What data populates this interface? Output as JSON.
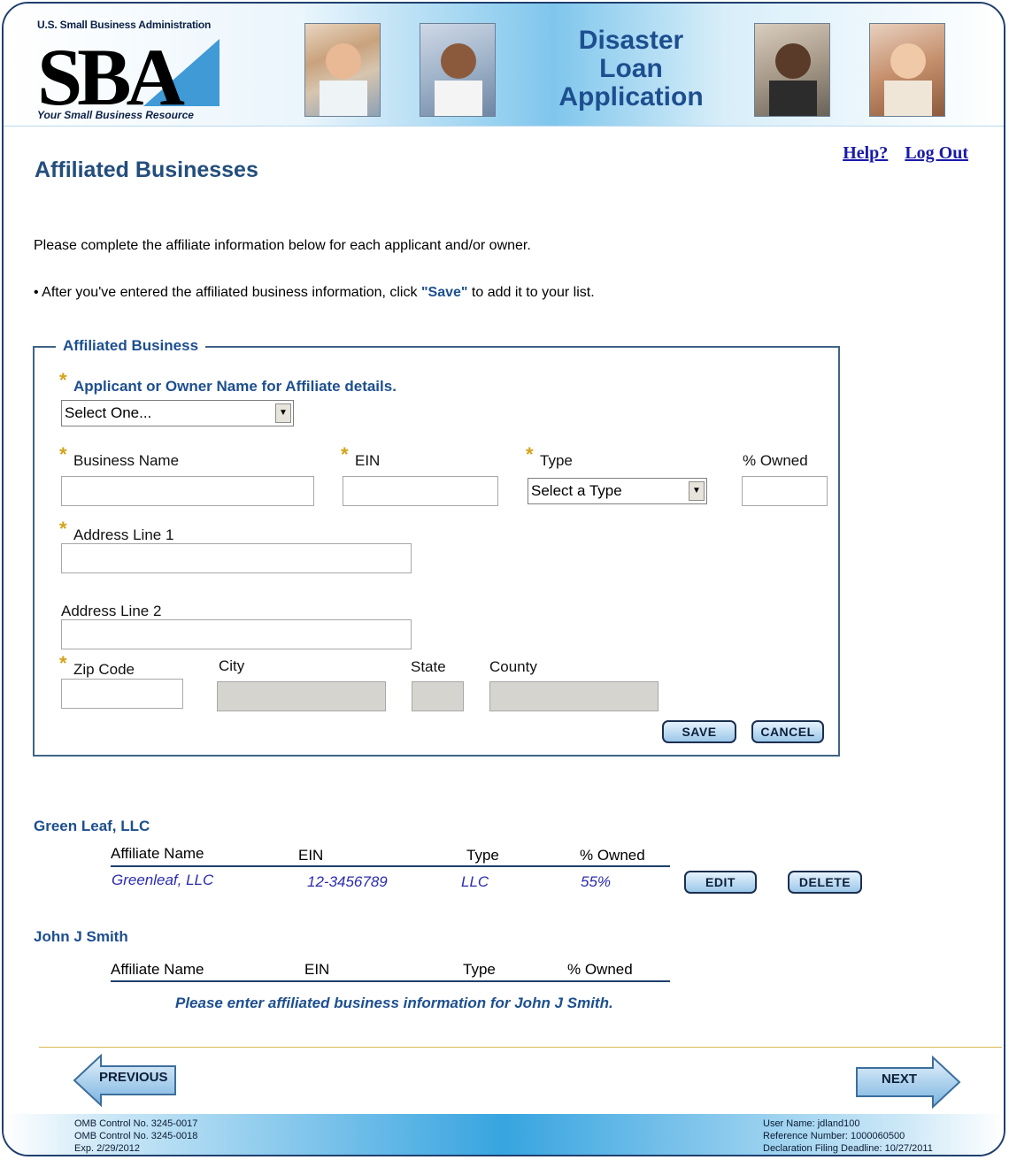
{
  "header": {
    "agency": "U.S. Small Business Administration",
    "logo_text": "SBA",
    "tagline": "Your Small Business Resource",
    "app_title_line1": "Disaster",
    "app_title_line2": "Loan",
    "app_title_line3": "Application",
    "help_link": "Help?",
    "logout_link": "Log Out"
  },
  "page": {
    "title": "Affiliated Businesses",
    "intro": "Please complete the affiliate information below for each applicant and/or owner.",
    "bullet_pre": "• After you've entered the affiliated business information, click ",
    "bullet_bold": "\"Save\"",
    "bullet_post": " to add it to your list."
  },
  "form": {
    "legend": "Affiliated Business",
    "owner_label": "Applicant or Owner Name for Affiliate details.",
    "owner_select": "Select One...",
    "business_name_label": "Business Name",
    "ein_label": "EIN",
    "type_label": "Type",
    "type_select": "Select a Type",
    "owned_label": "% Owned",
    "address1_label": "Address Line 1",
    "address2_label": "Address Line 2",
    "zip_label": "Zip Code",
    "city_label": "City",
    "state_label": "State",
    "county_label": "County",
    "save_button": "SAVE",
    "cancel_button": "CANCEL"
  },
  "columns": {
    "name": "Affiliate Name",
    "ein": "EIN",
    "type": "Type",
    "owned": "% Owned"
  },
  "groups": [
    {
      "owner": "Green Leaf, LLC",
      "row": {
        "name": "Greenleaf, LLC",
        "ein": "12-3456789",
        "type": "LLC",
        "owned": "55%"
      },
      "edit_button": "EDIT",
      "delete_button": "DELETE"
    },
    {
      "owner": "John J Smith",
      "empty_message": "Please enter affiliated business information for John J Smith."
    }
  ],
  "nav": {
    "previous": "PREVIOUS",
    "next": "NEXT"
  },
  "footer": {
    "omb1": "OMB Control No. 3245-0017",
    "omb2": "OMB Control No. 3245-0018",
    "exp": "Exp. 2/29/2012",
    "user": "User Name: jdland100",
    "reference": "Reference Number: 1000060500",
    "deadline": "Declaration Filing Deadline:  10/27/2011"
  }
}
